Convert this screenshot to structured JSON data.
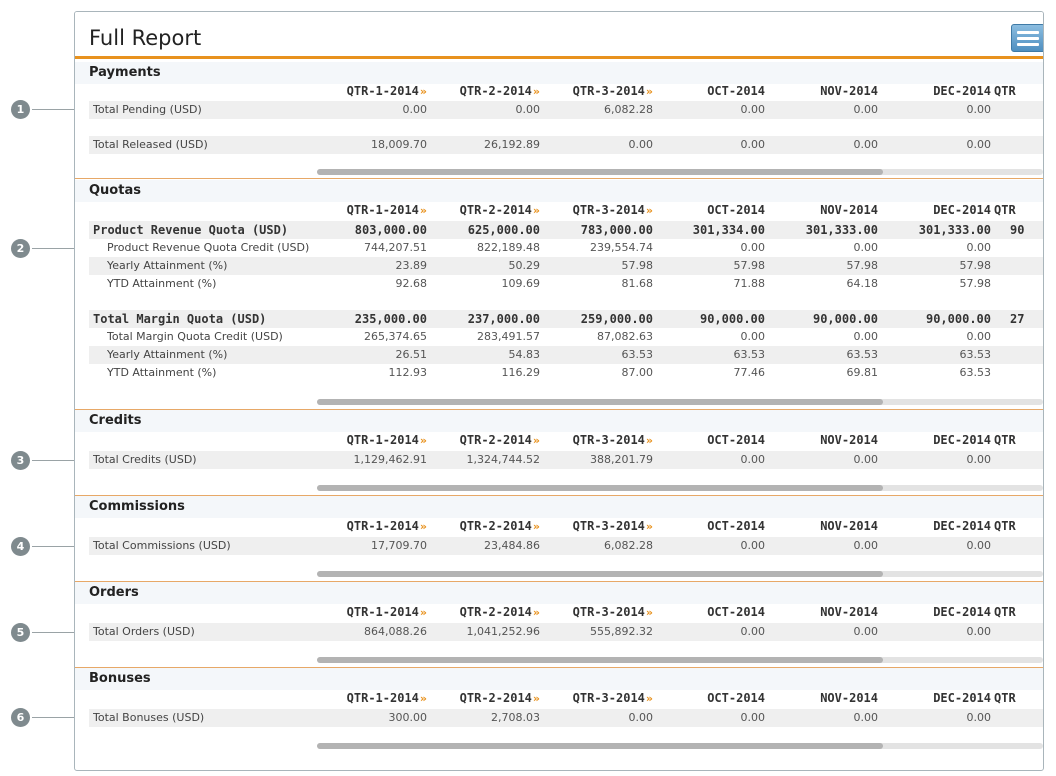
{
  "title": "Full Report",
  "columns": [
    "QTR-1-2014",
    "QTR-2-2014",
    "QTR-3-2014",
    "OCT-2014",
    "NOV-2014",
    "DEC-2014",
    "QTR"
  ],
  "quarter_marker": "»",
  "callouts": [
    "1",
    "2",
    "3",
    "4",
    "5",
    "6"
  ],
  "sections": {
    "payments": {
      "title": "Payments",
      "rows": [
        {
          "label": "Total Pending (USD)",
          "values": [
            "0.00",
            "0.00",
            "6,082.28",
            "0.00",
            "0.00",
            "0.00",
            ""
          ]
        },
        {
          "label": "Total Released (USD)",
          "values": [
            "18,009.70",
            "26,192.89",
            "0.00",
            "0.00",
            "0.00",
            "0.00",
            ""
          ]
        }
      ]
    },
    "quotas": {
      "title": "Quotas",
      "rows": [
        {
          "label": "Product Revenue Quota (USD)",
          "values": [
            "803,000.00",
            "625,000.00",
            "783,000.00",
            "301,334.00",
            "301,333.00",
            "301,333.00",
            "90"
          ]
        },
        {
          "label": "Product Revenue Quota Credit (USD)",
          "values": [
            "744,207.51",
            "822,189.48",
            "239,554.74",
            "0.00",
            "0.00",
            "0.00",
            ""
          ]
        },
        {
          "label": "Yearly Attainment (%)",
          "values": [
            "23.89",
            "50.29",
            "57.98",
            "57.98",
            "57.98",
            "57.98",
            ""
          ]
        },
        {
          "label": "YTD Attainment (%)",
          "values": [
            "92.68",
            "109.69",
            "81.68",
            "71.88",
            "64.18",
            "57.98",
            ""
          ]
        },
        {
          "label": "Total Margin Quota (USD)",
          "values": [
            "235,000.00",
            "237,000.00",
            "259,000.00",
            "90,000.00",
            "90,000.00",
            "90,000.00",
            "27"
          ]
        },
        {
          "label": "Total Margin Quota Credit (USD)",
          "values": [
            "265,374.65",
            "283,491.57",
            "87,082.63",
            "0.00",
            "0.00",
            "0.00",
            ""
          ]
        },
        {
          "label": "Yearly Attainment (%)",
          "values": [
            "26.51",
            "54.83",
            "63.53",
            "63.53",
            "63.53",
            "63.53",
            ""
          ]
        },
        {
          "label": "YTD Attainment (%)",
          "values": [
            "112.93",
            "116.29",
            "87.00",
            "77.46",
            "69.81",
            "63.53",
            ""
          ]
        }
      ]
    },
    "credits": {
      "title": "Credits",
      "rows": [
        {
          "label": "Total Credits (USD)",
          "values": [
            "1,129,462.91",
            "1,324,744.52",
            "388,201.79",
            "0.00",
            "0.00",
            "0.00",
            ""
          ]
        }
      ]
    },
    "commissions": {
      "title": "Commissions",
      "rows": [
        {
          "label": "Total Commissions (USD)",
          "values": [
            "17,709.70",
            "23,484.86",
            "6,082.28",
            "0.00",
            "0.00",
            "0.00",
            ""
          ]
        }
      ]
    },
    "orders": {
      "title": "Orders",
      "rows": [
        {
          "label": "Total Orders (USD)",
          "values": [
            "864,088.26",
            "1,041,252.96",
            "555,892.32",
            "0.00",
            "0.00",
            "0.00",
            ""
          ]
        }
      ]
    },
    "bonuses": {
      "title": "Bonuses",
      "rows": [
        {
          "label": "Total Bonuses (USD)",
          "values": [
            "300.00",
            "2,708.03",
            "0.00",
            "0.00",
            "0.00",
            "0.00",
            ""
          ]
        }
      ]
    }
  },
  "colors": {
    "accent": "#e8921e",
    "row_shade": "#efefef",
    "menu_button": "#5b9ac8"
  }
}
